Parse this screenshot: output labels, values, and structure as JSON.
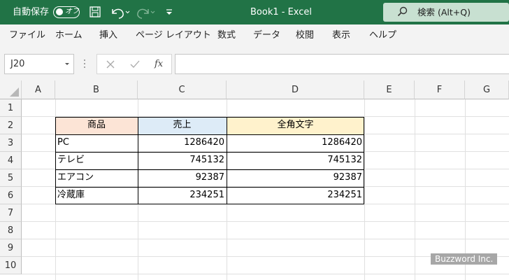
{
  "titlebar": {
    "autosave_label": "自動保存",
    "autosave_state": "オフ",
    "title": "Book1  -  Excel",
    "search_placeholder": "検索 (Alt+Q)"
  },
  "menu": [
    "ファイル",
    "ホーム",
    "挿入",
    "ページ レイアウト",
    "数式",
    "データ",
    "校閲",
    "表示",
    "ヘルプ"
  ],
  "formula_bar": {
    "name_box": "J20",
    "fx_label": "fx",
    "formula": ""
  },
  "columns": [
    "A",
    "B",
    "C",
    "D",
    "E",
    "F",
    "G"
  ],
  "rows": [
    "1",
    "2",
    "3",
    "4",
    "5",
    "6",
    "7",
    "8",
    "9",
    "10"
  ],
  "table": {
    "headers": [
      "商品",
      "売上",
      "全角文字"
    ],
    "header_colors": [
      "#fce4d6",
      "#ddebf7",
      "#fff2cc"
    ],
    "rows": [
      [
        "PC",
        "1286420",
        "1286420"
      ],
      [
        "テレビ",
        "745132",
        "745132"
      ],
      [
        "エアコン",
        "92387",
        "92387"
      ],
      [
        "冷蔵庫",
        "234251",
        "234251"
      ]
    ]
  },
  "watermark": "Buzzword Inc.",
  "colors": {
    "title_bg": "#217346",
    "search_bg": "#c8e0d1"
  }
}
